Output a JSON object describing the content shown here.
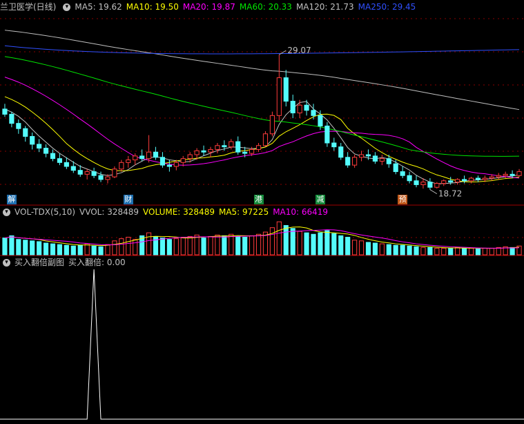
{
  "main": {
    "title": "兰卫医学(日线)",
    "ma_labels": [
      {
        "name": "ma5",
        "text": "MA5: 19.62",
        "color": "#c0c0c0"
      },
      {
        "name": "ma10",
        "text": "MA10: 19.50",
        "color": "#ffff00"
      },
      {
        "name": "ma20",
        "text": "MA20: 19.87",
        "color": "#ff00ff"
      },
      {
        "name": "ma60",
        "text": "MA60: 20.33",
        "color": "#00e600"
      },
      {
        "name": "ma120",
        "text": "MA120: 21.73",
        "color": "#c0c0c0"
      },
      {
        "name": "ma250",
        "text": "MA250: 29.45",
        "color": "#3050ff"
      }
    ],
    "high_label": "29.07",
    "low_label": "18.72",
    "events": [
      {
        "text": "解",
        "bg": "#1e6fb0",
        "color": "#ffffff"
      },
      {
        "text": "财",
        "bg": "#1e6fb0",
        "color": "#ffffff"
      },
      {
        "text": "港",
        "bg": "#138a3a",
        "color": "#ffffff"
      },
      {
        "text": "减",
        "bg": "#138a3a",
        "color": "#ffffff"
      },
      {
        "text": "预",
        "bg": "#c0581a",
        "color": "#ffffff"
      }
    ]
  },
  "volume": {
    "title": "VOL-TDX(5,10)",
    "labels": [
      {
        "name": "vvol",
        "text": "VVOL: 328489",
        "color": "#c0c0c0"
      },
      {
        "name": "volume",
        "text": "VOLUME: 328489",
        "color": "#ffff00"
      },
      {
        "name": "vma5",
        "text": "MA5: 97225",
        "color": "#ffff00"
      },
      {
        "name": "vma10",
        "text": "MA10: 66419",
        "color": "#ff00ff"
      }
    ]
  },
  "indicator": {
    "title": "买入翻倍副图",
    "value_text": "买入翻倍: 0.00"
  },
  "colors": {
    "up": "#ff3c3c",
    "down": "#54fcfc",
    "grid": "#8b0000",
    "separator": "#a00000"
  },
  "chart_data": {
    "type": "candlestick",
    "high": 29.07,
    "low": 18.72,
    "ohlc": [
      [
        24.9,
        25.3,
        24.3,
        24.5
      ],
      [
        24.5,
        24.7,
        23.5,
        23.8
      ],
      [
        23.8,
        24.1,
        23.0,
        23.4
      ],
      [
        23.4,
        23.6,
        22.4,
        22.8
      ],
      [
        22.8,
        23.1,
        21.8,
        22.2
      ],
      [
        22.2,
        22.6,
        21.6,
        21.9
      ],
      [
        21.9,
        22.2,
        21.2,
        21.5
      ],
      [
        21.5,
        21.8,
        20.9,
        21.1
      ],
      [
        21.1,
        21.5,
        20.6,
        20.8
      ],
      [
        20.8,
        21.2,
        20.3,
        20.5
      ],
      [
        20.5,
        20.9,
        20.0,
        20.2
      ],
      [
        20.2,
        20.6,
        19.7,
        19.9
      ],
      [
        19.9,
        20.3,
        19.5,
        20.1
      ],
      [
        20.1,
        20.4,
        19.6,
        19.8
      ],
      [
        19.8,
        20.1,
        19.3,
        19.5
      ],
      [
        19.5,
        19.9,
        19.2,
        19.7
      ],
      [
        19.7,
        20.5,
        19.6,
        20.3
      ],
      [
        20.3,
        21.0,
        20.1,
        20.8
      ],
      [
        20.8,
        21.3,
        20.4,
        21.0
      ],
      [
        21.0,
        21.5,
        20.6,
        21.3
      ],
      [
        21.3,
        21.8,
        20.9,
        21.1
      ],
      [
        21.1,
        22.9,
        20.8,
        21.6
      ],
      [
        21.6,
        22.0,
        21.0,
        21.2
      ],
      [
        21.2,
        21.6,
        20.4,
        20.6
      ],
      [
        20.6,
        21.0,
        20.1,
        20.5
      ],
      [
        20.5,
        21.0,
        20.2,
        20.8
      ],
      [
        20.8,
        21.3,
        20.5,
        21.1
      ],
      [
        21.1,
        21.6,
        20.8,
        21.4
      ],
      [
        21.4,
        21.9,
        21.0,
        21.7
      ],
      [
        21.7,
        22.1,
        21.3,
        21.6
      ],
      [
        21.6,
        22.0,
        21.2,
        21.8
      ],
      [
        21.8,
        22.3,
        21.5,
        22.1
      ],
      [
        22.1,
        22.5,
        21.7,
        22.0
      ],
      [
        22.0,
        22.6,
        21.8,
        22.4
      ],
      [
        22.4,
        22.8,
        21.4,
        21.6
      ],
      [
        21.6,
        22.0,
        21.2,
        21.5
      ],
      [
        21.5,
        22.0,
        21.3,
        21.8
      ],
      [
        21.8,
        22.3,
        21.6,
        22.1
      ],
      [
        22.1,
        23.2,
        22.0,
        23.0
      ],
      [
        23.0,
        24.7,
        22.8,
        24.4
      ],
      [
        24.4,
        29.07,
        24.0,
        27.3
      ],
      [
        27.3,
        27.9,
        25.1,
        25.5
      ],
      [
        25.5,
        26.0,
        24.2,
        24.6
      ],
      [
        24.6,
        25.6,
        24.2,
        25.2
      ],
      [
        25.2,
        25.6,
        24.4,
        24.8
      ],
      [
        24.8,
        25.3,
        24.1,
        24.4
      ],
      [
        24.4,
        24.8,
        23.3,
        23.6
      ],
      [
        23.6,
        23.9,
        22.0,
        22.3
      ],
      [
        22.3,
        22.7,
        21.7,
        22.0
      ],
      [
        22.0,
        22.3,
        21.0,
        21.2
      ],
      [
        21.2,
        21.6,
        20.4,
        20.6
      ],
      [
        20.6,
        21.4,
        20.4,
        21.2
      ],
      [
        21.2,
        21.7,
        20.9,
        21.4
      ],
      [
        21.4,
        21.8,
        21.0,
        21.3
      ],
      [
        21.3,
        21.6,
        20.7,
        20.9
      ],
      [
        20.9,
        21.4,
        20.6,
        21.1
      ],
      [
        21.1,
        21.4,
        20.4,
        20.7
      ],
      [
        20.7,
        21.0,
        19.9,
        20.1
      ],
      [
        20.1,
        20.5,
        19.6,
        19.8
      ],
      [
        19.8,
        20.1,
        19.2,
        19.4
      ],
      [
        19.4,
        19.8,
        18.9,
        19.1
      ],
      [
        19.1,
        19.6,
        18.8,
        19.3
      ],
      [
        19.3,
        19.6,
        18.72,
        18.9
      ],
      [
        18.9,
        19.3,
        18.8,
        19.2
      ],
      [
        19.2,
        19.5,
        19.0,
        19.4
      ],
      [
        19.4,
        19.7,
        19.1,
        19.3
      ],
      [
        19.3,
        19.6,
        19.1,
        19.5
      ],
      [
        19.5,
        19.8,
        19.2,
        19.4
      ],
      [
        19.4,
        19.7,
        19.2,
        19.6
      ],
      [
        19.6,
        19.8,
        19.3,
        19.5
      ],
      [
        19.5,
        19.8,
        19.3,
        19.6
      ],
      [
        19.6,
        19.9,
        19.4,
        19.7
      ],
      [
        19.7,
        20.0,
        19.5,
        19.8
      ],
      [
        19.8,
        20.1,
        19.6,
        19.9
      ],
      [
        19.9,
        20.2,
        19.6,
        19.8
      ],
      [
        19.8,
        20.3,
        19.7,
        20.1
      ]
    ],
    "volume": [
      23,
      26,
      21,
      20,
      19,
      18,
      16,
      15,
      14,
      13,
      12,
      13,
      15,
      12,
      11,
      14,
      19,
      22,
      24,
      21,
      26,
      30,
      25,
      23,
      21,
      22,
      24,
      25,
      27,
      23,
      25,
      27,
      26,
      28,
      25,
      24,
      26,
      28,
      31,
      37,
      45,
      40,
      36,
      32,
      30,
      28,
      30,
      33,
      29,
      26,
      24,
      20,
      19,
      17,
      16,
      15,
      14,
      13,
      13,
      12,
      11,
      10,
      10,
      9,
      9,
      9,
      10,
      9,
      9,
      8,
      9,
      9,
      10,
      11,
      10,
      12
    ],
    "buy_double_spike_index": 13,
    "buy_double_spike_value": 1
  }
}
